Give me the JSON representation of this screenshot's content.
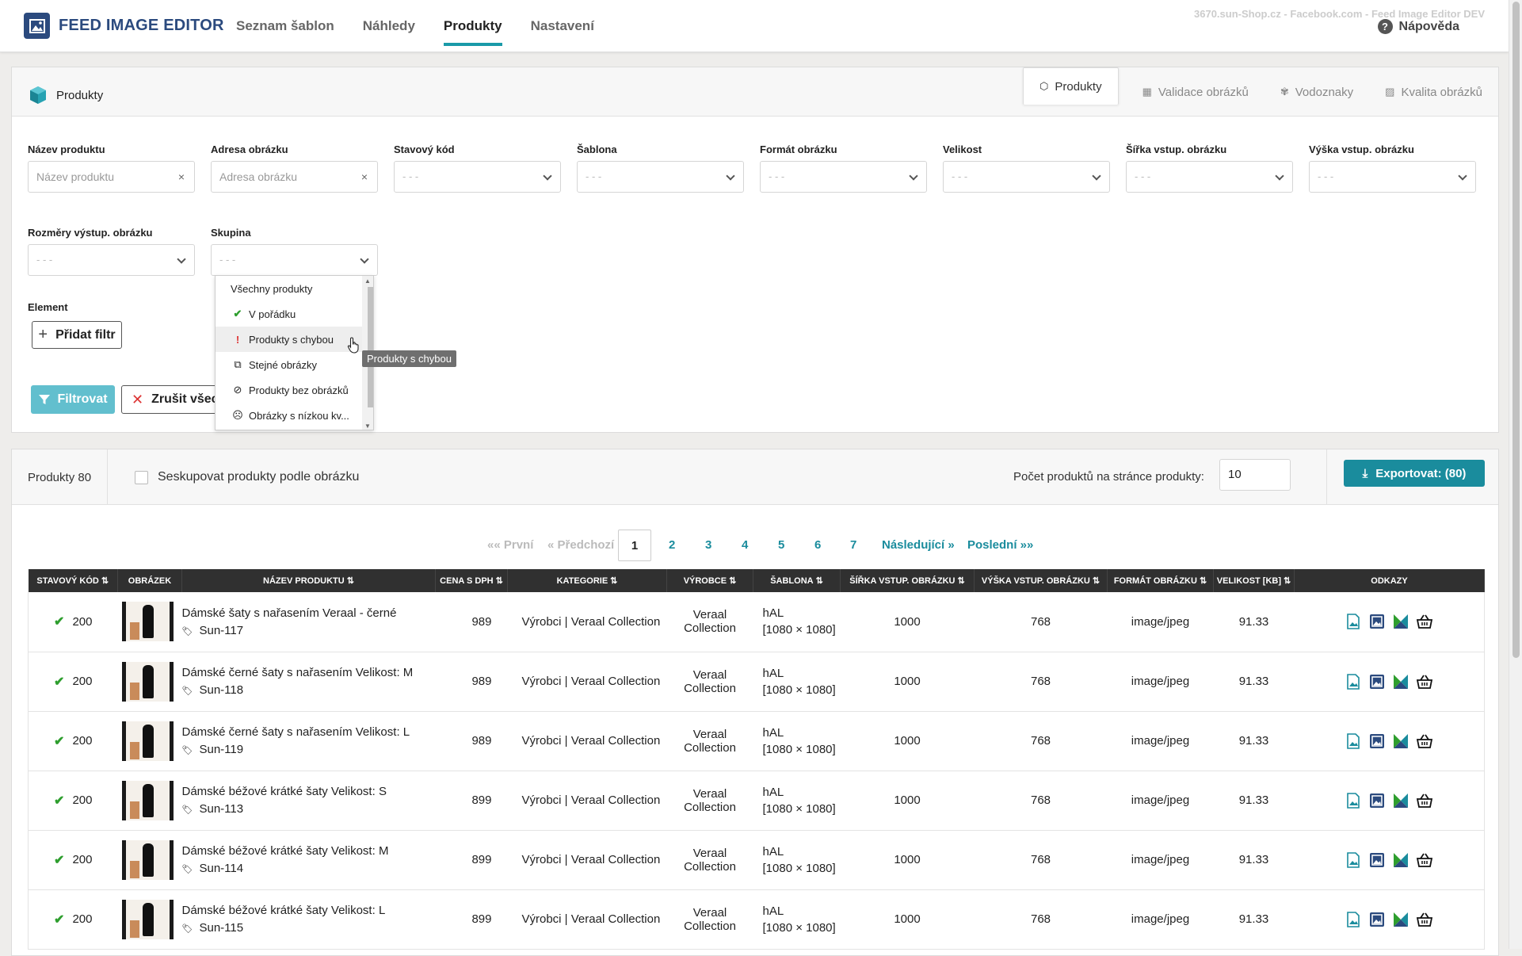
{
  "header": {
    "app_title": "FEED IMAGE EDITOR",
    "nav": [
      {
        "label": "Seznam šablon",
        "active": false
      },
      {
        "label": "Náhledy",
        "active": false
      },
      {
        "label": "Produkty",
        "active": true
      },
      {
        "label": "Nastavení",
        "active": false
      }
    ],
    "env": "3670.sun-Shop.cz - Facebook.com - Feed Image Editor DEV",
    "help": "Nápověda"
  },
  "filter_panel": {
    "title": "Produkty",
    "tabs": [
      {
        "label": "Produkty",
        "icon": "cube-icon",
        "active": true
      },
      {
        "label": "Validace obrázků",
        "icon": "validation-icon",
        "active": false
      },
      {
        "label": "Vodoznaky",
        "icon": "watermark-icon",
        "active": false
      },
      {
        "label": "Kvalita obrázků",
        "icon": "image-icon",
        "active": false
      }
    ],
    "fields": {
      "product_name": {
        "label": "Název produktu",
        "placeholder": "Název produktu"
      },
      "image_url": {
        "label": "Adresa obrázku",
        "placeholder": "Adresa obrázku"
      },
      "status_code": {
        "label": "Stavový kód",
        "value": "- - -"
      },
      "template": {
        "label": "Šablona",
        "value": "- - -"
      },
      "image_format": {
        "label": "Formát obrázku",
        "value": "- - -"
      },
      "size": {
        "label": "Velikost",
        "value": "- - -"
      },
      "input_width": {
        "label": "Šířka vstup. obrázku",
        "value": "- - -"
      },
      "input_height": {
        "label": "Výška vstup. obrázku",
        "value": "- - -"
      },
      "output_dims": {
        "label": "Rozměry výstup. obrázku",
        "value": "- - -"
      },
      "group": {
        "label": "Skupina",
        "value": "- - -"
      }
    },
    "element_label": "Element",
    "add_filter": "Přidat filtr",
    "filter_button": "Filtrovat",
    "clear_button": "Zrušit všechny filtry"
  },
  "group_dropdown": {
    "items": [
      {
        "label": "Všechny produkty",
        "icon": ""
      },
      {
        "label": "V pořádku",
        "icon": "check-icon"
      },
      {
        "label": "Produkty s chybou",
        "icon": "exclamation-icon"
      },
      {
        "label": "Stejné obrázky",
        "icon": "copy-icon"
      },
      {
        "label": "Produkty bez obrázků",
        "icon": "eye-slash-icon"
      },
      {
        "label": "Obrázky s nízkou kv...",
        "icon": "sad-face-icon"
      }
    ],
    "hovered_index": 2,
    "tooltip": "Produkty s chybou"
  },
  "products": {
    "count_label": "Produkty 80",
    "group_by_image": "Seskupovat produkty podle obrázku",
    "group_by_image_checked": false,
    "per_page_label": "Počet produktů na stránce produkty:",
    "per_page_value": "10",
    "export_button": "Exportovat: (80)",
    "pagination": {
      "first": "«« První",
      "prev": "« Předchozí",
      "pages": [
        "1",
        "2",
        "3",
        "4",
        "5",
        "6",
        "7"
      ],
      "current": "1",
      "next": "Následující »",
      "last": "Poslední »»"
    },
    "columns": [
      "STAVOVÝ KÓD",
      "OBRÁZEK",
      "NÁZEV PRODUKTU",
      "CENA S DPH",
      "KATEGORIE",
      "VÝROBCE",
      "ŠABLONA",
      "ŠÍŘKA VSTUP. OBRÁZKU",
      "VÝŠKA VSTUP. OBRÁZKU",
      "FORMÁT OBRÁZKU",
      "VELIKOST [KB]",
      "ODKAZY"
    ],
    "rows": [
      {
        "status": "200",
        "name": "Dámské šaty s nařasením Veraal - černé",
        "sku": "Sun-117",
        "price": "989",
        "category": "Výrobci | Veraal Collection",
        "manufacturer": "Veraal Collection",
        "template": "hAL",
        "template_dims": "[1080 × 1080]",
        "width": "1000",
        "height": "768",
        "format": "image/jpeg",
        "size": "91.33"
      },
      {
        "status": "200",
        "name": "Dámské černé šaty s nařasením Velikost: M",
        "sku": "Sun-118",
        "price": "989",
        "category": "Výrobci | Veraal Collection",
        "manufacturer": "Veraal Collection",
        "template": "hAL",
        "template_dims": "[1080 × 1080]",
        "width": "1000",
        "height": "768",
        "format": "image/jpeg",
        "size": "91.33"
      },
      {
        "status": "200",
        "name": "Dámské černé šaty s nařasením Velikost: L",
        "sku": "Sun-119",
        "price": "989",
        "category": "Výrobci | Veraal Collection",
        "manufacturer": "Veraal Collection",
        "template": "hAL",
        "template_dims": "[1080 × 1080]",
        "width": "1000",
        "height": "768",
        "format": "image/jpeg",
        "size": "91.33"
      },
      {
        "status": "200",
        "name": "Dámské béžové krátké šaty Velikost: S",
        "sku": "Sun-113",
        "price": "899",
        "category": "Výrobci | Veraal Collection",
        "manufacturer": "Veraal Collection",
        "template": "hAL",
        "template_dims": "[1080 × 1080]",
        "width": "1000",
        "height": "768",
        "format": "image/jpeg",
        "size": "91.33"
      },
      {
        "status": "200",
        "name": "Dámské béžové krátké šaty Velikost: M",
        "sku": "Sun-114",
        "price": "899",
        "category": "Výrobci | Veraal Collection",
        "manufacturer": "Veraal Collection",
        "template": "hAL",
        "template_dims": "[1080 × 1080]",
        "width": "1000",
        "height": "768",
        "format": "image/jpeg",
        "size": "91.33"
      },
      {
        "status": "200",
        "name": "Dámské béžové krátké šaty Velikost: L",
        "sku": "Sun-115",
        "price": "899",
        "category": "Výrobci | Veraal Collection",
        "manufacturer": "Veraal Collection",
        "template": "hAL",
        "template_dims": "[1080 × 1080]",
        "width": "1000",
        "height": "768",
        "format": "image/jpeg",
        "size": "91.33"
      }
    ]
  },
  "colors": {
    "accent": "#1a9aa8",
    "brand": "#2b4a7e",
    "ok": "#2e9e2e",
    "error": "#d33"
  }
}
